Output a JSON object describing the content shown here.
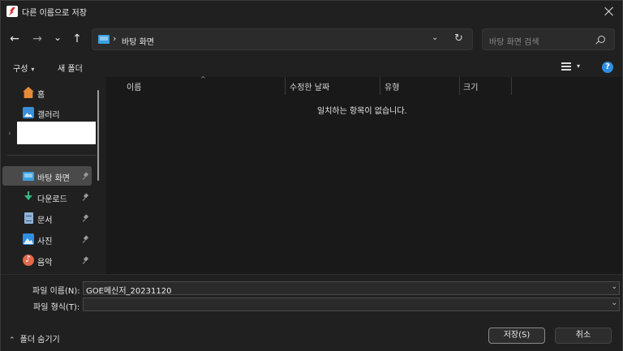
{
  "window": {
    "title": "다른 이름으로 저장"
  },
  "nav": {
    "back": "←",
    "forward": "→",
    "recent": "⌄",
    "up": "↑"
  },
  "address": {
    "separator": "›",
    "location": "바탕 화면",
    "dropdown": "⌄",
    "refresh": "↻"
  },
  "search": {
    "placeholder": "바탕 화면 검색"
  },
  "commandbar": {
    "organize": "구성",
    "organize_caret": "▾",
    "new_folder": "새 폴더",
    "view_caret": "▾",
    "help": "?"
  },
  "sidebar": {
    "items": [
      {
        "label": "홈",
        "icon": "home-icon"
      },
      {
        "label": "갤러리",
        "icon": "gallery-icon"
      },
      {
        "label": "바탕 화면",
        "icon": "desktop-icon",
        "pinned": true,
        "selected": true
      },
      {
        "label": "다운로드",
        "icon": "download-icon",
        "pinned": true
      },
      {
        "label": "문서",
        "icon": "document-icon",
        "pinned": true
      },
      {
        "label": "사진",
        "icon": "pictures-icon",
        "pinned": true
      },
      {
        "label": "음악",
        "icon": "music-icon",
        "pinned": true
      }
    ],
    "expander": "›"
  },
  "columns": {
    "sort_indicator": "^",
    "headers": [
      "이름",
      "수정한 날짜",
      "유형",
      "크기"
    ]
  },
  "content": {
    "empty_message": "일치하는 항목이 없습니다."
  },
  "form": {
    "filename_label": "파일 이름(N):",
    "filename_value": "GOE메신저_20231120",
    "filetype_label": "파일 형식(T):",
    "filetype_value": "",
    "dropdown": "⌄"
  },
  "footer": {
    "hide_caret": "⌃",
    "hide_folders": "폴더 숨기기",
    "save": "저장(S)",
    "cancel": "취소"
  },
  "colors": {
    "accent": "#2f8ee0",
    "background": "#202020",
    "content_background": "#191919",
    "selected": "#4a4a4a"
  }
}
